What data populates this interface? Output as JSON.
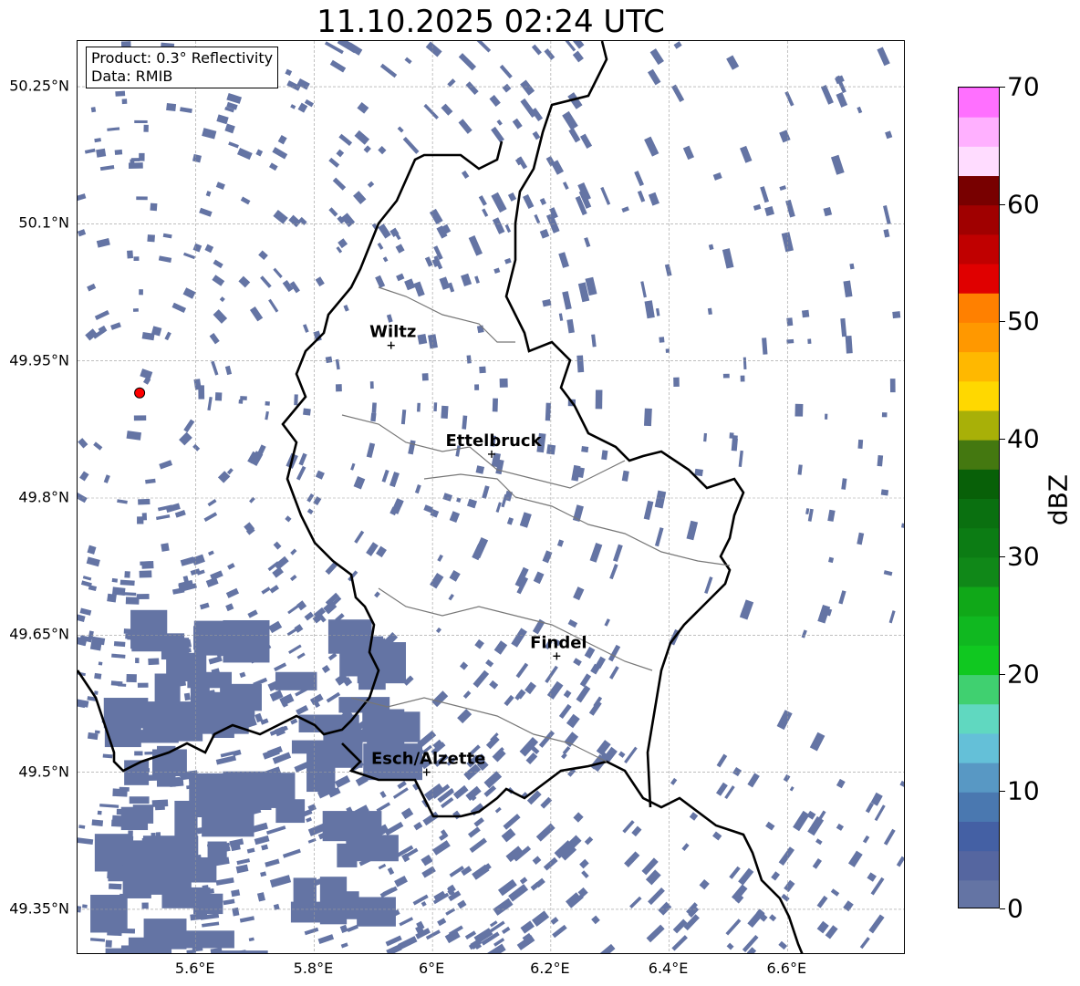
{
  "title": "11.10.2025 02:24 UTC",
  "info": {
    "product": "Product: 0.3° Reflectivity",
    "data": "Data: RMIB"
  },
  "axes": {
    "lon_range": [
      5.4,
      6.8
    ],
    "lat_range": [
      49.3,
      50.3
    ],
    "x_ticks": [
      {
        "value": 5.6,
        "label": "5.6°E"
      },
      {
        "value": 5.8,
        "label": "5.8°E"
      },
      {
        "value": 6.0,
        "label": "6°E"
      },
      {
        "value": 6.2,
        "label": "6.2°E"
      },
      {
        "value": 6.4,
        "label": "6.4°E"
      },
      {
        "value": 6.6,
        "label": "6.6°E"
      }
    ],
    "y_ticks": [
      {
        "value": 50.25,
        "label": "50.25°N"
      },
      {
        "value": 50.1,
        "label": "50.1°N"
      },
      {
        "value": 49.95,
        "label": "49.95°N"
      },
      {
        "value": 49.8,
        "label": "49.8°N"
      },
      {
        "value": 49.65,
        "label": "49.65°N"
      },
      {
        "value": 49.5,
        "label": "49.5°N"
      },
      {
        "value": 49.35,
        "label": "49.35°N"
      }
    ]
  },
  "radar": {
    "lon": 5.505,
    "lat": 49.915,
    "color": "#ff0000"
  },
  "cities": [
    {
      "name": "Wiltz",
      "lon": 5.93,
      "lat": 49.967
    },
    {
      "name": "Ettelbruck",
      "lon": 6.1,
      "lat": 49.848
    },
    {
      "name": "Findel",
      "lon": 6.21,
      "lat": 49.627
    },
    {
      "name": "Esch/Alzette",
      "lon": 5.99,
      "lat": 49.5
    }
  ],
  "colorbar": {
    "label": "dBZ",
    "min": 0,
    "max": 70,
    "step": 2.5,
    "ticks": [
      {
        "value": 0,
        "label": "0"
      },
      {
        "value": 10,
        "label": "10"
      },
      {
        "value": 20,
        "label": "20"
      },
      {
        "value": 30,
        "label": "30"
      },
      {
        "value": 40,
        "label": "40"
      },
      {
        "value": 50,
        "label": "50"
      },
      {
        "value": 60,
        "label": "60"
      },
      {
        "value": 70,
        "label": "70"
      }
    ],
    "colors": [
      "#6474a4",
      "#5566a0",
      "#4460a4",
      "#4a78b0",
      "#5898c4",
      "#64c0d8",
      "#60d8c0",
      "#40d070",
      "#10c820",
      "#10b820",
      "#10a818",
      "#108818",
      "#0c7c14",
      "#0a7010",
      "#086008",
      "#447810",
      "#a8b008",
      "#ffd800",
      "#ffb800",
      "#ff9800",
      "#ff8000",
      "#e00000",
      "#c00000",
      "#a00000",
      "#780000",
      "#ffdcff",
      "#ffb0ff",
      "#ff70ff",
      "#e838e8"
    ]
  },
  "echo_color": "#6474a4",
  "grid": true
}
